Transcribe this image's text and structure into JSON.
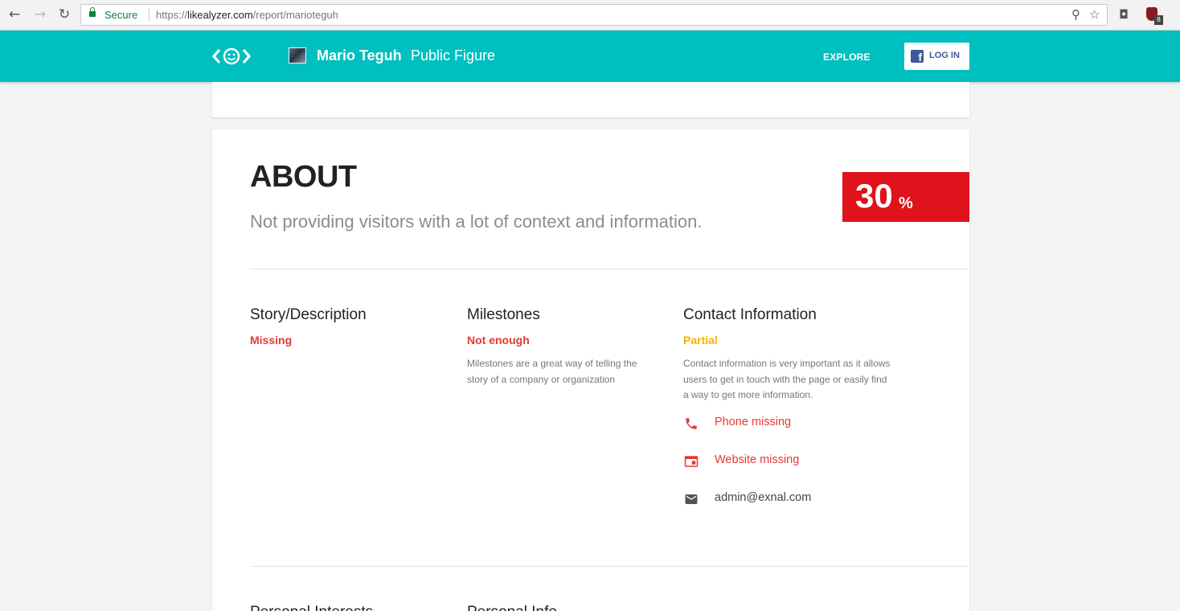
{
  "browser": {
    "secure_label": "Secure",
    "url_scheme": "https://",
    "url_domain": "likealyzer.com",
    "url_path": "/report/marioteguh",
    "extension_badge": "8"
  },
  "header": {
    "page_name": "Mario Teguh",
    "page_category": "Public Figure",
    "explore_label": "EXPLORE",
    "login_label": "LOG IN",
    "brand_color": "#00bfbf"
  },
  "about": {
    "title": "ABOUT",
    "subtitle": "Not providing visitors with a lot of context and information.",
    "score": "30",
    "score_unit": "%",
    "score_color": "#e0121b"
  },
  "columns": [
    {
      "title": "Story/Description",
      "status": "Missing",
      "description": ""
    },
    {
      "title": "Milestones",
      "status": "Not enough",
      "description": "Milestones are a great way of telling the story of a company or organization"
    },
    {
      "title": "Contact Information",
      "status": "Partial",
      "description": "Contact information is very important as it allows users to get in touch with the page or easily find a way to get more information."
    }
  ],
  "contacts": [
    {
      "icon": "phone-icon",
      "text": "Phone missing"
    },
    {
      "icon": "website-icon",
      "text": "Website missing"
    },
    {
      "icon": "email-icon",
      "text": "admin@exnal.com"
    }
  ],
  "next_section": [
    {
      "title": "Personal Interests"
    },
    {
      "title": "Personal Info"
    }
  ]
}
